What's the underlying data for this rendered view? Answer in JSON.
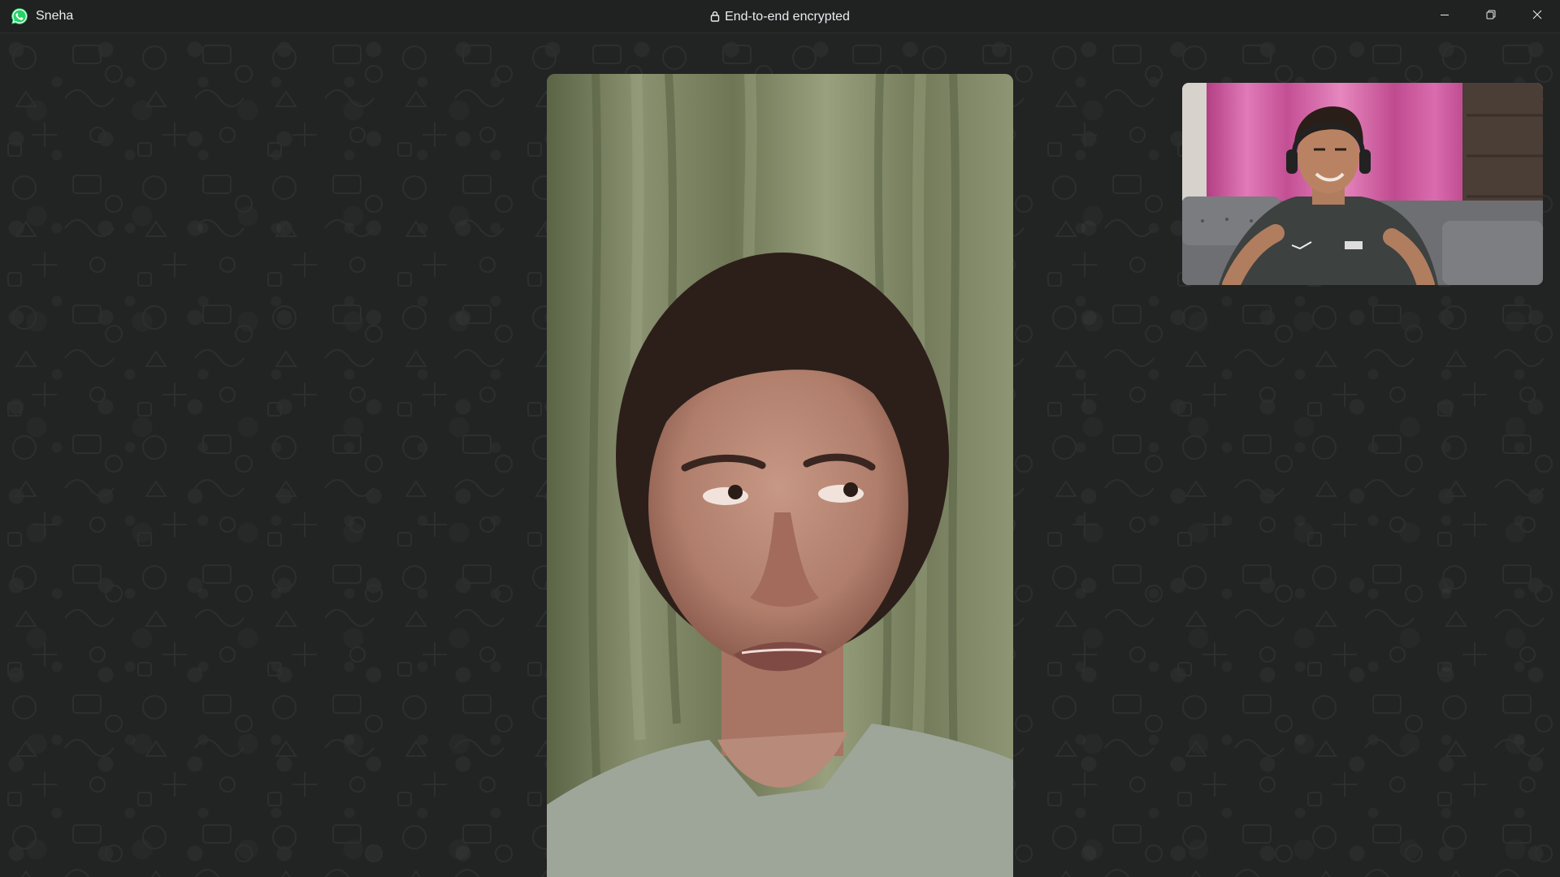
{
  "window": {
    "contact_name": "Sneha",
    "encryption_label": "End-to-end encrypted"
  },
  "icons": {
    "app_logo": "whatsapp-icon",
    "lock": "lock-icon",
    "minimize": "minimize-icon",
    "restore": "restore-icon",
    "close": "close-icon"
  },
  "colors": {
    "titlebar_bg": "#202121",
    "call_bg": "#222323",
    "brand_green": "#25d366",
    "text": "#e9edef"
  }
}
